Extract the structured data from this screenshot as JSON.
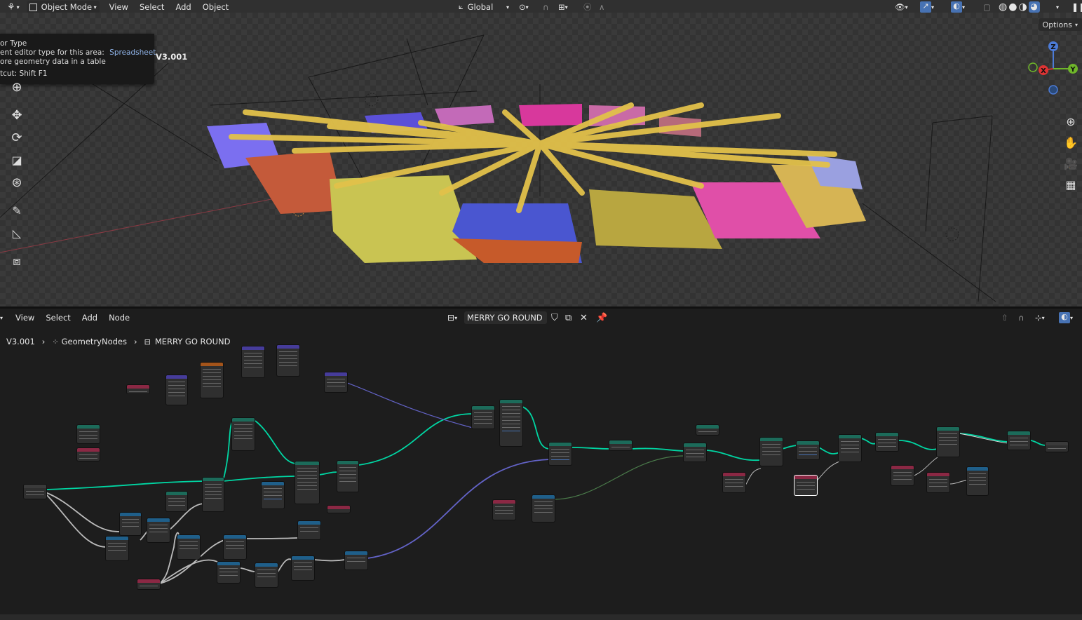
{
  "viewport_header": {
    "mode_label": "Object Mode",
    "menus": [
      "View",
      "Select",
      "Add",
      "Object"
    ],
    "transform_orientation": "Global",
    "options_label": "Options"
  },
  "tooltip": {
    "title": "or Type",
    "line1_prefix": "ent editor type for this area:",
    "line1_value": "Spreadsheet",
    "line2": "ore geometry data in a table",
    "shortcut": "tcut: Shift F1"
  },
  "viewport": {
    "object_name": "V3.001",
    "gizmo": {
      "x_label": "X",
      "y_label": "Y",
      "z_label": "Z"
    }
  },
  "node_header": {
    "menus": [
      "View",
      "Select",
      "Add",
      "Node"
    ],
    "node_tree_name": "MERRY GO ROUND"
  },
  "breadcrumb": {
    "object": "V3.001",
    "modifier": "GeometryNodes",
    "node_tree": "MERRY GO ROUND"
  },
  "colors": {
    "geometry_socket": "#00d6a3",
    "vector_socket": "#6363c7",
    "float_socket": "#a1a1a1",
    "header_bg": "#303030",
    "accent_blue": "#4772b3"
  }
}
